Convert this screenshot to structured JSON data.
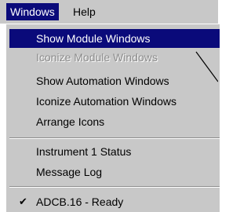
{
  "menubar": {
    "windows_label": "Windows",
    "help_label": "Help"
  },
  "menu": {
    "items": [
      {
        "label": "Show Module Windows",
        "state": "highlighted"
      },
      {
        "label": "Iconize Module Windows",
        "state": "disabled"
      },
      {
        "label": "Show Automation Windows",
        "state": "enabled"
      },
      {
        "label": "Iconize Automation Windows",
        "state": "enabled"
      },
      {
        "label": "Arrange Icons",
        "state": "enabled"
      },
      {
        "label": "Instrument 1 Status",
        "state": "enabled"
      },
      {
        "label": "Message Log",
        "state": "enabled"
      },
      {
        "label": "ADCB.16 - Ready",
        "state": "checked"
      }
    ]
  },
  "colors": {
    "menu_background": "#c8c8c8",
    "highlight": "#0a0a7a",
    "disabled_text": "#8c8c8c"
  }
}
